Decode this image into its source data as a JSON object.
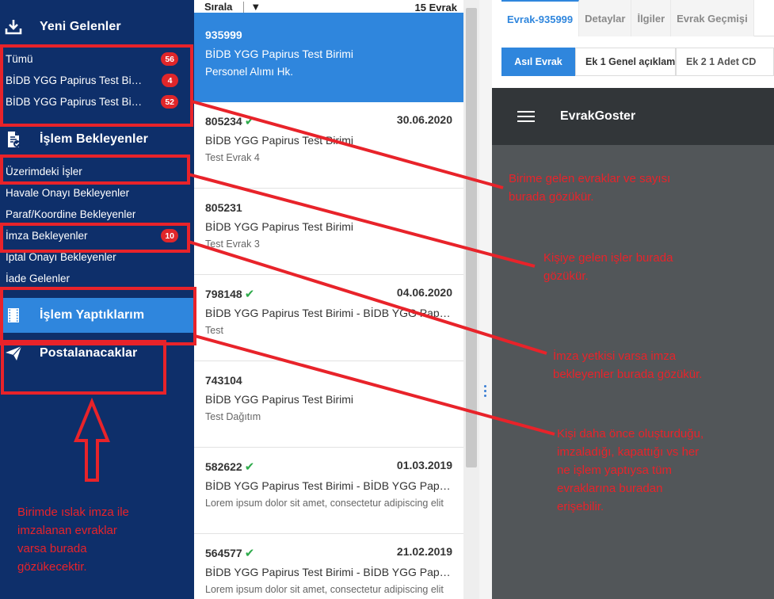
{
  "sidebar": {
    "new_section": {
      "label": "Yeni Gelenler",
      "icon": "download-icon"
    },
    "new_items": [
      {
        "label": "Tümü",
        "count": "56"
      },
      {
        "label": "BİDB YGG Papirus Test Birimi",
        "count": "4"
      },
      {
        "label": "BİDB YGG Papirus Test Birimi",
        "count": "52"
      }
    ],
    "pending_section": {
      "label": "İşlem Bekleyenler",
      "icon": "document-check-icon"
    },
    "pending_items": [
      {
        "label": "Üzerimdeki İşler",
        "count": ""
      },
      {
        "label": "Havale Onayı Bekleyenler",
        "count": ""
      },
      {
        "label": "Paraf/Koordine Bekleyenler",
        "count": ""
      },
      {
        "label": "İmza Bekleyenler",
        "count": "10"
      },
      {
        "label": "İptal Onayı Bekleyenler",
        "count": ""
      },
      {
        "label": "İade Gelenler",
        "count": ""
      }
    ],
    "done_section": {
      "label": "İşlem Yaptıklarım",
      "icon": "film-icon"
    },
    "mail_section": {
      "label": "Postalanacaklar",
      "icon": "paper-plane-icon"
    }
  },
  "list": {
    "sort_label": "Sırala",
    "count_label": "15 Evrak",
    "items": [
      {
        "id": "935999",
        "date": "",
        "checked": false,
        "line2": "BİDB YGG Papirus Test Birimi",
        "line3": "Personel Alımı Hk."
      },
      {
        "id": "805234",
        "date": "30.06.2020",
        "checked": true,
        "line2": "BİDB YGG Papirus Test Birimi",
        "line3": "Test Evrak 4"
      },
      {
        "id": "805231",
        "date": "",
        "checked": false,
        "line2": "BİDB YGG Papirus Test Birimi",
        "line3": "Test Evrak 3"
      },
      {
        "id": "798148",
        "date": "04.06.2020",
        "checked": true,
        "line2": "BİDB YGG Papirus Test Birimi - BİDB YGG Papirus Test Birimi",
        "line3": "Test"
      },
      {
        "id": "743104",
        "date": "",
        "checked": false,
        "line2": "BİDB YGG Papirus Test Birimi",
        "line3": "Test Dağıtım"
      },
      {
        "id": "582622",
        "date": "01.03.2019",
        "checked": true,
        "line2": "BİDB YGG Papirus Test Birimi - BİDB YGG Papirus Test Birimi",
        "line3": "Lorem ipsum dolor sit amet, consectetur adipiscing elit"
      },
      {
        "id": "564577",
        "date": "21.02.2019",
        "checked": true,
        "line2": "BİDB YGG Papirus Test Birimi - BİDB YGG Papirus Test Birimi",
        "line3": "Lorem ipsum dolor sit amet, consectetur adipiscing elit"
      }
    ]
  },
  "detail": {
    "tabs": [
      "Evrak-935999",
      "Detaylar",
      "İlgiler",
      "Evrak Geçmişi"
    ],
    "subtabs": [
      "Asıl Evrak",
      "Ek 1 Genel açıklama",
      "Ek 2 1 Adet CD"
    ],
    "viewer_title": "EvrakGoster"
  },
  "annotations": {
    "note1": [
      "Birime gelen evraklar ve sayısı",
      "burada gözükür."
    ],
    "note2": [
      "Kişiye gelen işler burada",
      "gözükür."
    ],
    "note3": [
      "İmza yetkisi varsa imza",
      "bekleyenler burada gözükür."
    ],
    "note4": [
      "Kişi daha önce oluşturduğu,",
      "imzaladığı, kapattığı vs her",
      "ne işlem yaptıysa tüm",
      "evraklarına buradan",
      "erişebilir."
    ],
    "note5": [
      "Birimde ıslak imza ile",
      "imzalanan evraklar",
      "varsa burada",
      "gözükecektir."
    ],
    "color": "#e8232a"
  }
}
